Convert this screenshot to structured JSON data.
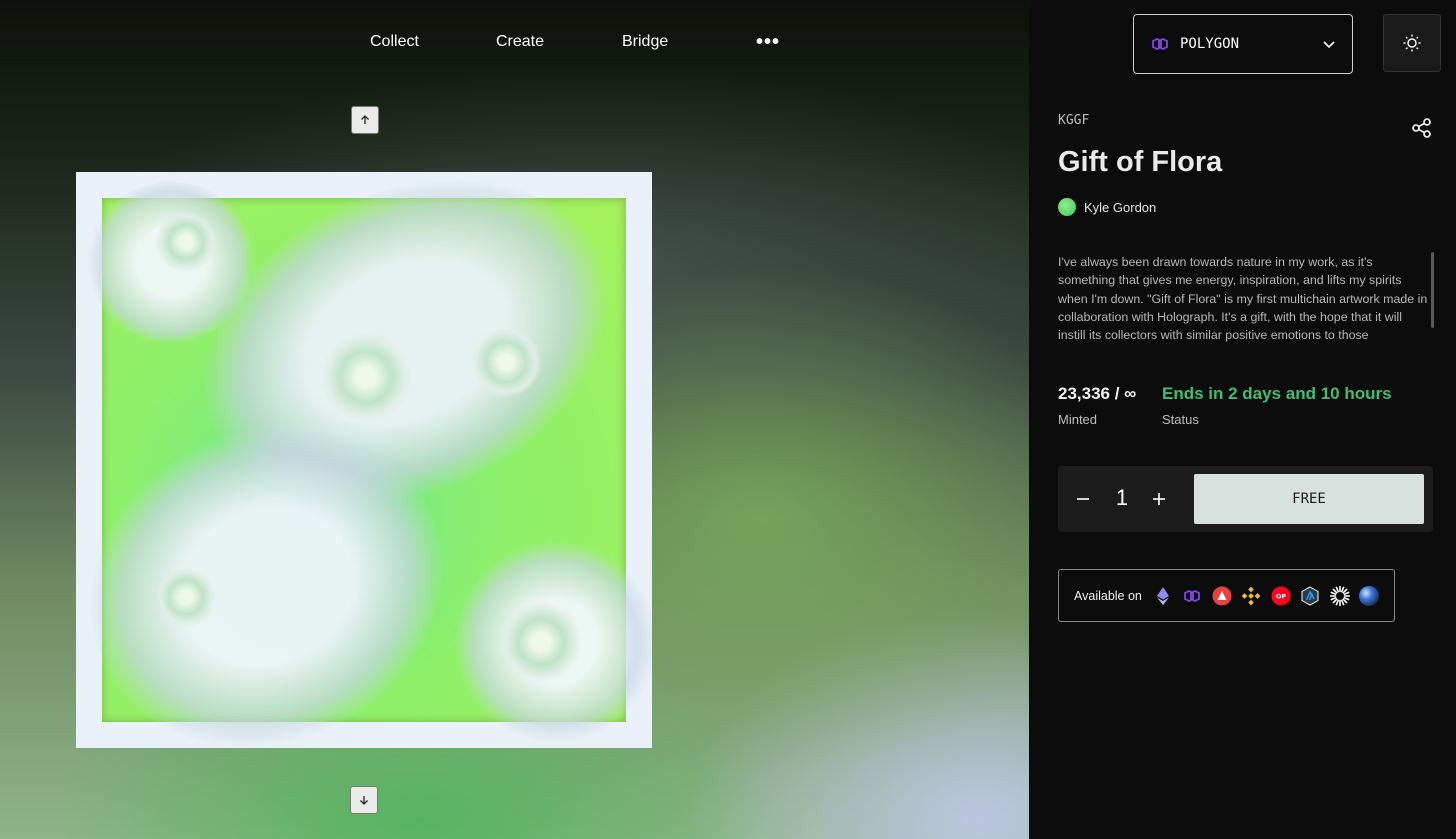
{
  "nav": {
    "items": [
      {
        "label": "Collect"
      },
      {
        "label": "Create"
      },
      {
        "label": "Bridge"
      }
    ],
    "more_label": "•••"
  },
  "chain_selector": {
    "value": "POLYGON",
    "icon": "polygon-icon"
  },
  "theme_toggle": {
    "icon": "sun-icon"
  },
  "collection_symbol": "KGGF",
  "title": "Gift of Flora",
  "creator": {
    "name": "Kyle Gordon"
  },
  "description": "I've always been drawn towards nature in my work, as it's something that gives me energy, inspiration, and lifts my spirits when I'm down. \"Gift of Flora\" is my first multichain artwork made in collaboration with Holograph. It's a gift, with the hope that it will instill its collectors with similar positive emotions to those",
  "stats": {
    "minted_value": "23,336 / ∞",
    "minted_label": "Minted",
    "status_value": "Ends in 2 days and 10 hours",
    "status_label": "Status"
  },
  "mint": {
    "quantity": "1",
    "button_label": "FREE"
  },
  "availability": {
    "label": "Available on",
    "chains": [
      "ethereum-icon",
      "polygon-icon",
      "avalanche-icon",
      "bnb-chain-icon",
      "optimism-icon",
      "arbitrum-icon",
      "zora-icon",
      "base-icon"
    ]
  },
  "colors": {
    "status_green": "#3fbf74",
    "polygon_purple": "#8247e5",
    "button_bg": "#d9e1de"
  }
}
